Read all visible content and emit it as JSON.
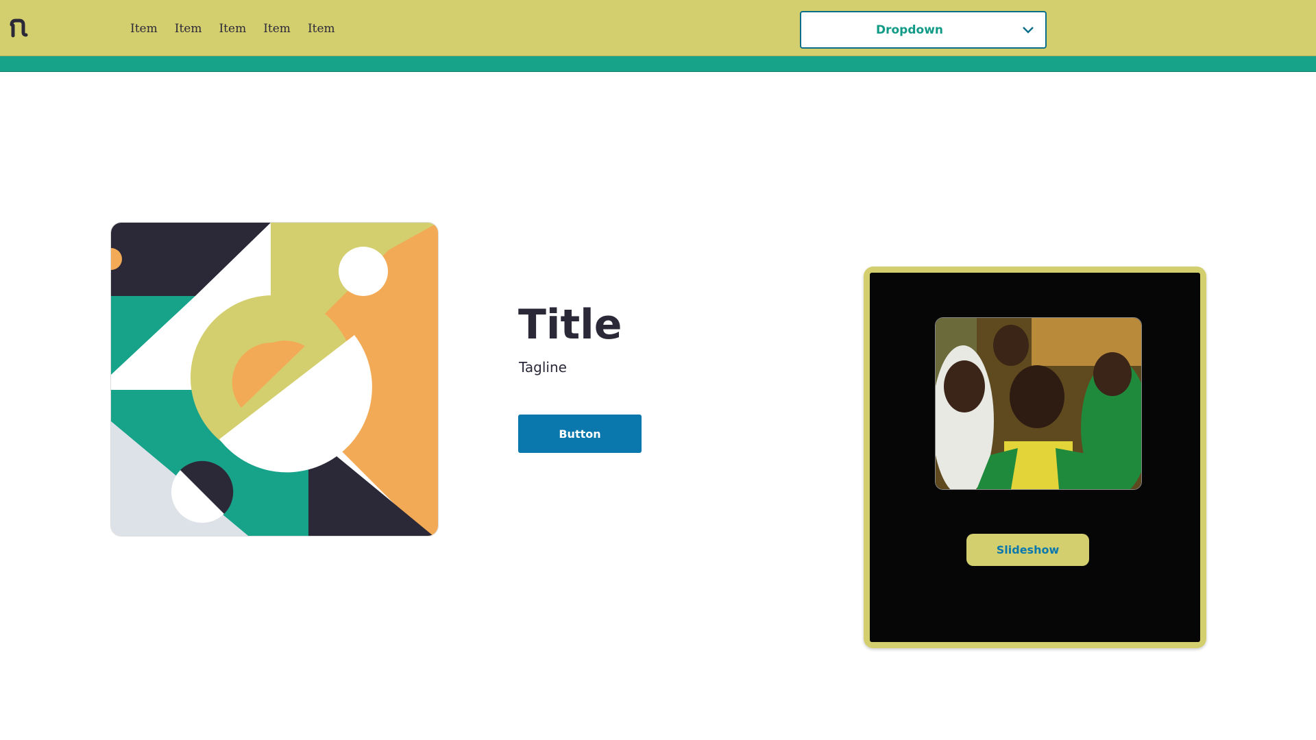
{
  "colors": {
    "header_bg": "#d4cf6e",
    "accent_teal": "#17a38a",
    "dark": "#2b2838",
    "primary_blue": "#0a78ad",
    "orange": "#f2aa56",
    "light_gray": "#dde2e8"
  },
  "header": {
    "logo_icon": "brand-logo-icon",
    "nav": [
      {
        "label": "Item"
      },
      {
        "label": "Item"
      },
      {
        "label": "Item"
      },
      {
        "label": "Item"
      },
      {
        "label": "Item"
      }
    ],
    "dropdown": {
      "label": "Dropdown",
      "icon": "chevron-down-icon"
    }
  },
  "hero": {
    "title": "Title",
    "tagline": "Tagline",
    "button_label": "Button",
    "illustration": "geometric-illustration"
  },
  "slideshow": {
    "image": "children-group-photo",
    "button_label": "Slideshow"
  }
}
